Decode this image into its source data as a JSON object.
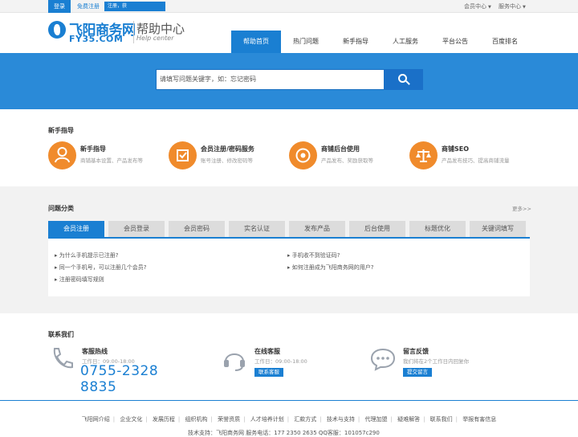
{
  "topbar": {
    "login": "登录",
    "register": "免费注册",
    "register_tip": "注册，获",
    "member_center": "会员中心",
    "service_center": "服务中心"
  },
  "brand": {
    "name_cn": "飞阳商务网",
    "name_en": "FY35.COM",
    "section_cn": "帮助中心",
    "section_en": "Help center",
    "color": "#1a7fd2"
  },
  "nav": [
    "帮助首页",
    "热门问题",
    "新手指导",
    "人工服务",
    "平台公告",
    "百度排名"
  ],
  "search": {
    "placeholder": "请填写问题关键字，如：忘记密码"
  },
  "guide": {
    "title": "新手指导",
    "items": [
      {
        "title": "新手指导",
        "desc": "商铺基本设置、产品发布等",
        "icon": "person-icon"
      },
      {
        "title": "会员注册/密码服务",
        "desc": "账号注册、修改密码等",
        "icon": "checkbox-icon"
      },
      {
        "title": "商铺后台使用",
        "desc": "产品发布、奖励获取等",
        "icon": "target-icon"
      },
      {
        "title": "商铺SEO",
        "desc": "产品发布技巧、提高商铺流量",
        "icon": "scale-icon"
      }
    ]
  },
  "categories": {
    "title": "问题分类",
    "more": "更多>>",
    "tabs": [
      "会员注册",
      "会员登录",
      "会员密码",
      "实名认证",
      "发布产品",
      "后台使用",
      "标题优化",
      "关键词填写"
    ],
    "left_questions": [
      "为什么手机提示已注册?",
      "同一个手机号，可以注册几个会员?",
      "注册密码填写规则"
    ],
    "right_questions": [
      "手机收不到验证码?",
      "如何注册成为飞阳商务网的用户?"
    ]
  },
  "contact": {
    "title": "联系我们",
    "hotline": {
      "title": "客服热线",
      "hours": "工作日：09:00-18:00",
      "phone": "0755-2328 8835"
    },
    "online": {
      "title": "在线客服",
      "hours": "工作日：09:00-18:00",
      "button": "联系客服"
    },
    "feedback": {
      "title": "留言反馈",
      "desc": "我们将在2个工作日内回复你",
      "button": "提交留言"
    }
  },
  "footer": {
    "links": [
      "飞阳网介绍",
      "企业文化",
      "发展历程",
      "组织机构",
      "荣誉资质",
      "人才培养计划",
      "汇款方式",
      "技术与支持",
      "代理加盟",
      "疑难解答",
      "联系我们",
      "举报有害信息"
    ],
    "bottom": "技术支持：飞阳商务网     服务电话：177 2350 2635      QQ客服：101057c290"
  }
}
